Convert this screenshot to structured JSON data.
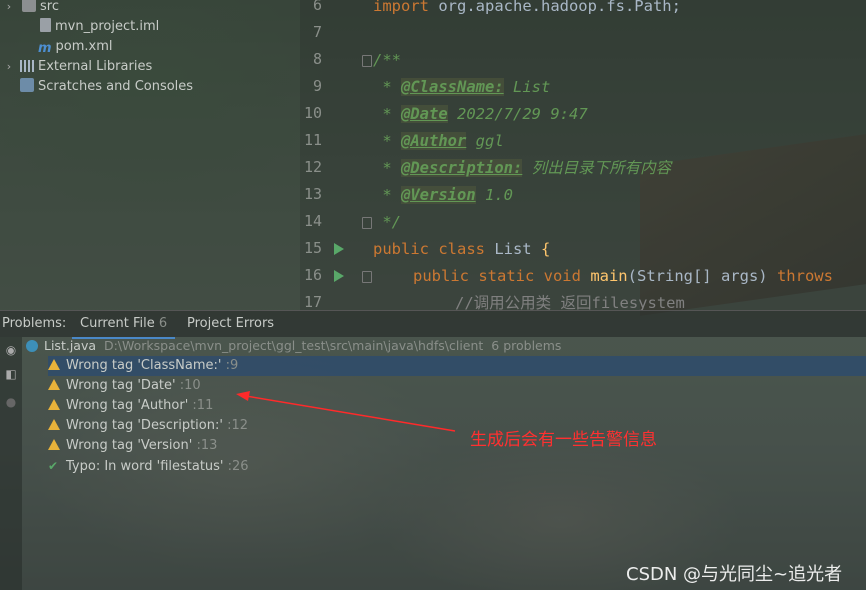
{
  "tree": {
    "items": [
      {
        "label": "src",
        "type": "folder"
      },
      {
        "label": "mvn_project.iml",
        "type": "file"
      },
      {
        "label": "pom.xml",
        "type": "maven"
      },
      {
        "label": "External Libraries",
        "type": "libraries"
      },
      {
        "label": "Scratches and Consoles",
        "type": "scratches"
      }
    ]
  },
  "editor": {
    "line_numbers": [
      "6",
      "7",
      "8",
      "9",
      "10",
      "11",
      "12",
      "13",
      "14",
      "15",
      "16",
      "17"
    ],
    "line6": {
      "kw": "import",
      "rest": " org.apache.hadoop.fs.Path;"
    },
    "line8": "/**",
    "javadoc": [
      {
        "prefix": " * ",
        "tag": "@ClassName:",
        "value": " List"
      },
      {
        "prefix": " * ",
        "tag": "@Date",
        "value": " 2022/7/29 9:47"
      },
      {
        "prefix": " * ",
        "tag": "@Author",
        "value": " ggl"
      },
      {
        "prefix": " * ",
        "tag": "@Description:",
        "value": " 列出目录下所有内容"
      },
      {
        "prefix": " * ",
        "tag": "@Version",
        "value": " 1.0"
      }
    ],
    "line14": " */",
    "line15": {
      "kw": "public class",
      "name": " List ",
      "brace": "{"
    },
    "line16": {
      "kw1": "public static void",
      "fn": " main",
      "args": "(String[] args) ",
      "kw2": "throws"
    },
    "line17": "//调用公用类 返回filesystem"
  },
  "problems": {
    "title": "Problems:",
    "tabs": [
      {
        "label": "Current File",
        "count": "6"
      },
      {
        "label": "Project Errors",
        "count": ""
      }
    ],
    "file": {
      "name": "List.java",
      "path": "D:\\Workspace\\mvn_project\\ggl_test\\src\\main\\java\\hdfs\\client",
      "summary": "6 problems"
    },
    "items": [
      {
        "text": "Wrong tag 'ClassName:'",
        "line": ":9",
        "kind": "warning"
      },
      {
        "text": "Wrong tag 'Date'",
        "line": ":10",
        "kind": "warning"
      },
      {
        "text": "Wrong tag 'Author'",
        "line": ":11",
        "kind": "warning"
      },
      {
        "text": "Wrong tag 'Description:'",
        "line": ":12",
        "kind": "warning"
      },
      {
        "text": "Wrong tag 'Version'",
        "line": ":13",
        "kind": "warning"
      },
      {
        "text": "Typo: In word 'filestatus'",
        "line": ":26",
        "kind": "typo"
      }
    ]
  },
  "annotation": "生成后会有一些告警信息",
  "watermark": "CSDN @与光同尘~追光者"
}
